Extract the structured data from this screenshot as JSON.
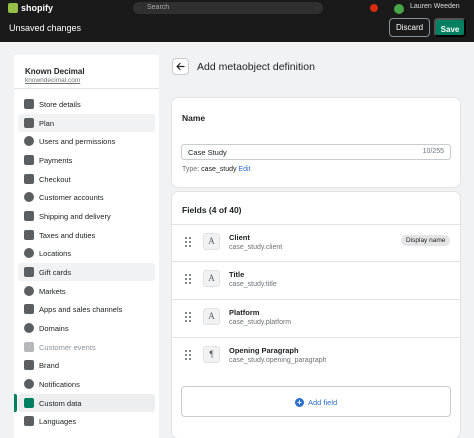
{
  "topbar": {
    "brand": "shopify",
    "search_placeholder": "Search",
    "store_user": "Lauren Weeden"
  },
  "savebar": {
    "title": "Unsaved changes",
    "discard_label": "Discard",
    "save_label": "Save"
  },
  "sidebar": {
    "store_name": "Known Decimal",
    "store_domain": "knowndecimal.com",
    "items": [
      {
        "label": "Store details",
        "icon": "store-icon"
      },
      {
        "label": "Plan",
        "icon": "plan-icon"
      },
      {
        "label": "Users and permissions",
        "icon": "user-icon"
      },
      {
        "label": "Payments",
        "icon": "payments-icon"
      },
      {
        "label": "Checkout",
        "icon": "cart-icon"
      },
      {
        "label": "Customer accounts",
        "icon": "customer-icon"
      },
      {
        "label": "Shipping and delivery",
        "icon": "truck-icon"
      },
      {
        "label": "Taxes and duties",
        "icon": "tax-icon"
      },
      {
        "label": "Locations",
        "icon": "location-icon"
      },
      {
        "label": "Gift cards",
        "icon": "gift-icon"
      },
      {
        "label": "Markets",
        "icon": "globe-icon"
      },
      {
        "label": "Apps and sales channels",
        "icon": "apps-icon"
      },
      {
        "label": "Domains",
        "icon": "globe-icon"
      },
      {
        "label": "Customer events",
        "icon": "events-icon"
      },
      {
        "label": "Brand",
        "icon": "brand-icon"
      },
      {
        "label": "Notifications",
        "icon": "bell-icon"
      },
      {
        "label": "Custom data",
        "icon": "custom-data-icon"
      },
      {
        "label": "Languages",
        "icon": "languages-icon"
      }
    ]
  },
  "page": {
    "title": "Add metaobject definition"
  },
  "name_card": {
    "heading": "Name",
    "name_value": "Case Study",
    "char_count": "10/255",
    "type_label": "Type:",
    "type_value": "case_study",
    "edit_label": "Edit"
  },
  "fields_card": {
    "heading": "Fields (4 of 40)",
    "fields": [
      {
        "name": "Client",
        "key": "case_study.client",
        "type_glyph": "A",
        "badge": "Display name"
      },
      {
        "name": "Title",
        "key": "case_study.title",
        "type_glyph": "A"
      },
      {
        "name": "Platform",
        "key": "case_study.platform",
        "type_glyph": "A"
      },
      {
        "name": "Opening Paragraph",
        "key": "case_study.opening_paragraph",
        "type_glyph": "¶"
      }
    ],
    "add_field_label": "Add field"
  },
  "colors": {
    "accent": "#008060",
    "link": "#2c6ecb",
    "bar": "#1a1a1a"
  }
}
